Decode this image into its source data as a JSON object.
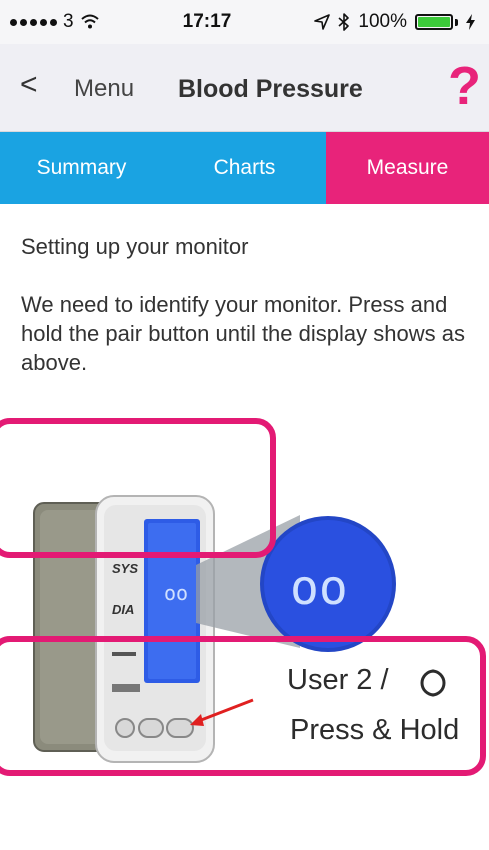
{
  "status_bar": {
    "carrier": "3",
    "time": "17:17",
    "battery": "100%",
    "icons": [
      "signal-dots-icon",
      "wifi-icon",
      "location-icon",
      "bluetooth-icon",
      "battery-icon",
      "charging-icon"
    ]
  },
  "nav": {
    "back_chevron": "<",
    "back_label": "Menu",
    "title": "Blood Pressure",
    "help": "?"
  },
  "tabs": [
    {
      "label": "Summary",
      "active": false
    },
    {
      "label": "Charts",
      "active": false
    },
    {
      "label": "Measure",
      "active": true
    }
  ],
  "content": {
    "title": "Setting up your monitor",
    "instructions": "We need to identify your monitor.  Press and hold the pair button until the display shows as above."
  },
  "illustration": {
    "display_labels": [
      "SYS",
      "DIA"
    ],
    "callout_user": "User 2 /",
    "callout_press": "Press & Hold"
  },
  "colors": {
    "accent_pink": "#e8237a",
    "tab_blue": "#1aa3e2",
    "lcd_blue": "#2e5ce6"
  }
}
